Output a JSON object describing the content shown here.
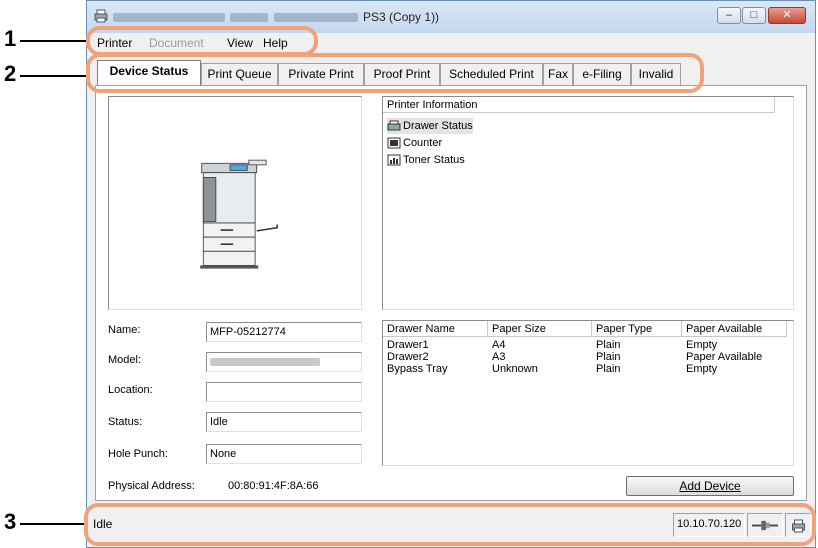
{
  "callouts": [
    "1",
    "2",
    "3"
  ],
  "window": {
    "title_suffix": "PS3 (Copy 1))",
    "minimize_glyph": "–",
    "maximize_glyph": "□",
    "close_glyph": "✕"
  },
  "menu": [
    "Printer",
    "Document",
    "View",
    "Help"
  ],
  "tabs": [
    "Device Status",
    "Print Queue",
    "Private Print",
    "Proof Print",
    "Scheduled Print",
    "Fax",
    "e-Filing",
    "Invalid"
  ],
  "device": {
    "labels": {
      "name": "Name:",
      "model": "Model:",
      "location": "Location:",
      "status": "Status:",
      "hole_punch": "Hole Punch:",
      "physical_address": "Physical Address:"
    },
    "values": {
      "name": "MFP-05212774",
      "location": "",
      "status": "Idle",
      "hole_punch": "None",
      "physical_address": "00:80:91:4F:8A:66"
    }
  },
  "tree": {
    "header": "Printer Information",
    "items": [
      "Drawer Status",
      "Counter",
      "Toner Status"
    ]
  },
  "drawers": {
    "columns": [
      "Drawer Name",
      "Paper Size",
      "Paper Type",
      "Paper Available"
    ],
    "rows": [
      [
        "Drawer1",
        "A4",
        "Plain",
        "Empty"
      ],
      [
        "Drawer2",
        "A3",
        "Plain",
        "Paper Available"
      ],
      [
        "Bypass Tray",
        "Unknown",
        "Plain",
        "Empty"
      ]
    ]
  },
  "buttons": {
    "add_device": "Add Device"
  },
  "statusbar": {
    "text": "Idle",
    "ip": "10.10.70.120"
  },
  "colors": {
    "callout_ring": "#f0a27a",
    "title_gradient_top": "#dbe8f6",
    "close_button": "#c64a35"
  },
  "icons": [
    "app-printer-icon",
    "drawer-icon",
    "counter-icon",
    "toner-icon",
    "connection-icon",
    "printer-status-icon"
  ]
}
